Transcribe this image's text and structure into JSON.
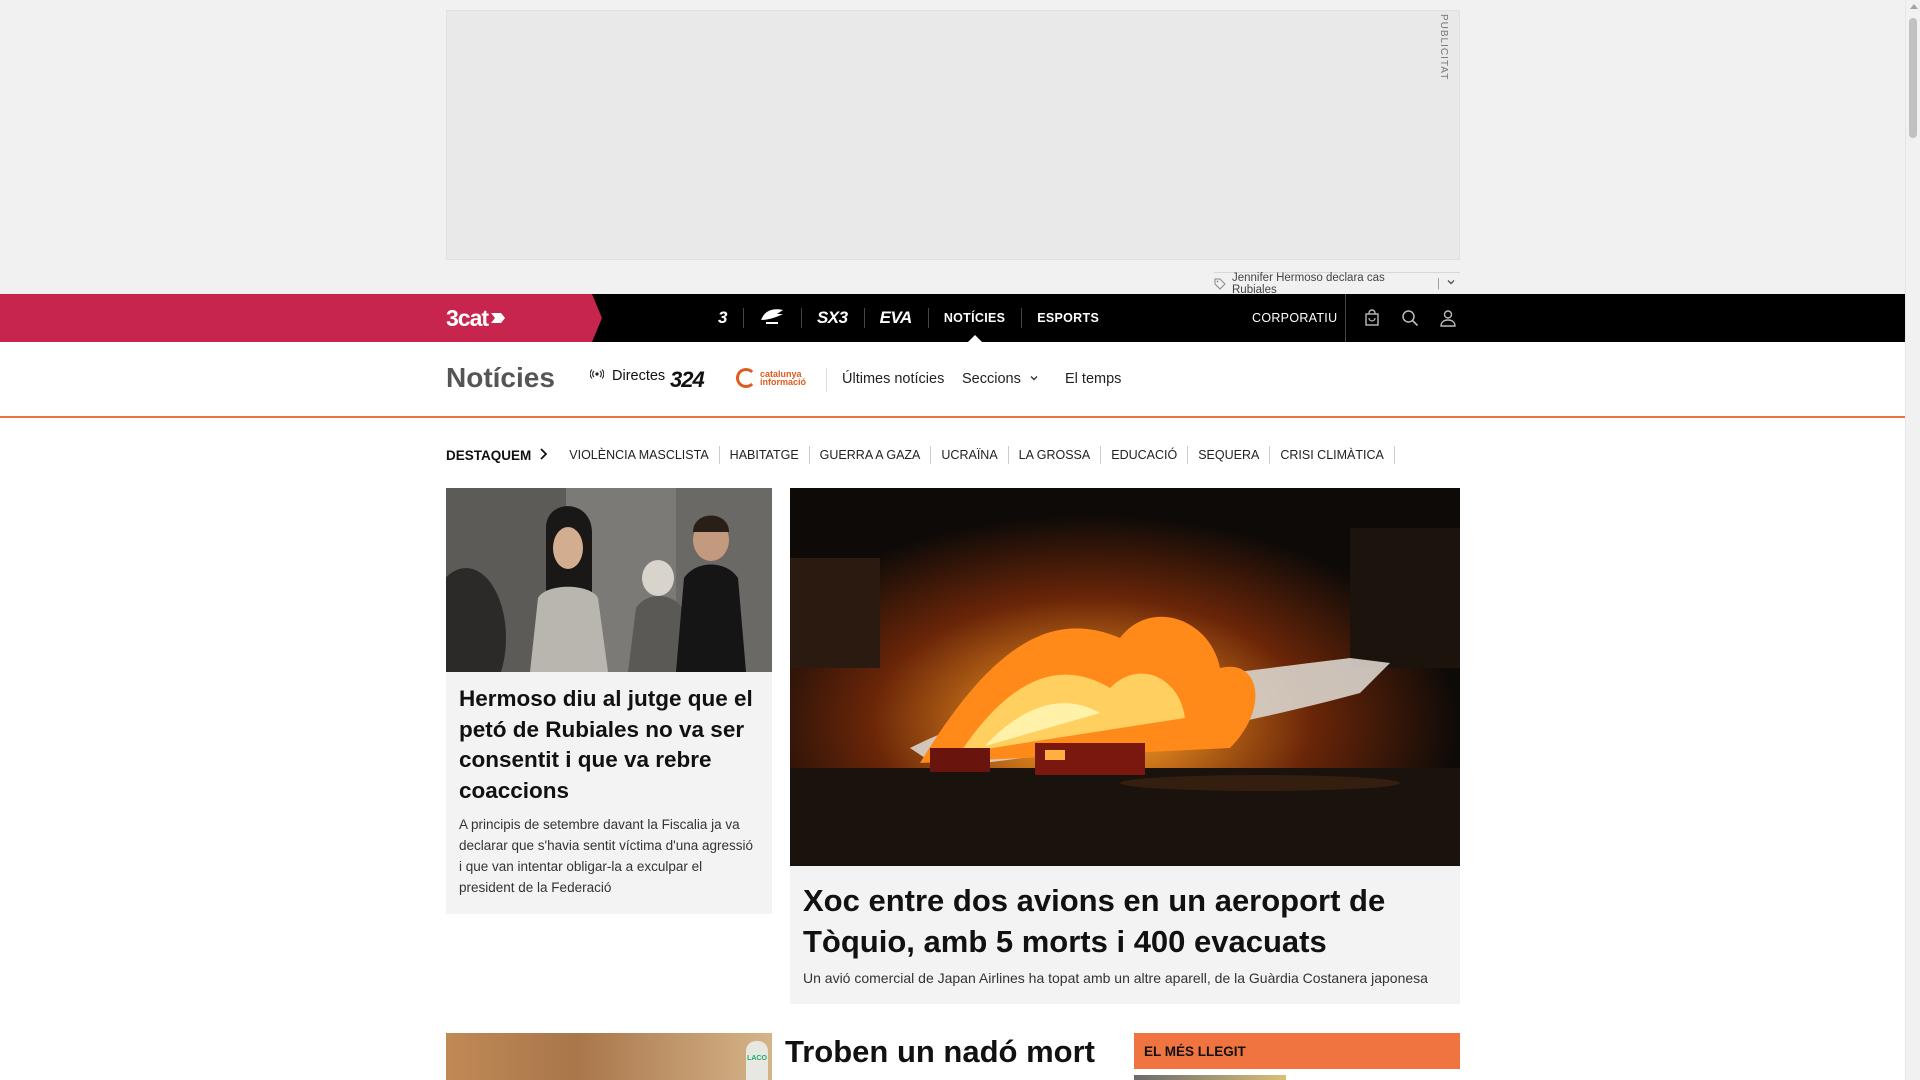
{
  "ad": {
    "label": "PUBLICITAT",
    "tag_text": "Jennifer Hermoso declara cas Rubiales",
    "tag_separator": "|"
  },
  "topnav": {
    "brand": "3cat",
    "channels": [
      {
        "label": "3",
        "icon": "tv3-logo"
      },
      {
        "label": "Cat Ràdio",
        "icon": "catradio-logo"
      },
      {
        "label": "SX3",
        "icon": "sx3-logo"
      },
      {
        "label": "EVA",
        "icon": "eva-logo"
      },
      {
        "label": "NOTÍCIES",
        "active": true
      },
      {
        "label": "ESPORTS"
      }
    ],
    "corporatiu": "CORPORATIU",
    "icons": [
      "shopping-bag-icon",
      "search-icon",
      "user-icon"
    ]
  },
  "section": {
    "title": "Notícies",
    "directes": "Directes",
    "logo_324": "324",
    "logo_catinfo_line1": "catalunya",
    "logo_catinfo_line2": "informació",
    "links": {
      "ultimes": "Últimes notícies",
      "seccions": "Seccions",
      "temps": "El temps"
    }
  },
  "destaquem": {
    "title": "DESTAQUEM",
    "items": [
      "VIOLÈNCIA MASCLISTA",
      "HABITATGE",
      "GUERRA A GAZA",
      "UCRAÏNA",
      "LA GROSSA",
      "EDUCACIÓ",
      "SEQUERA",
      "CRISI CLIMÀTICA"
    ]
  },
  "articles": {
    "left": {
      "headline": "Hermoso diu al jutge que el petó de Rubiales no va ser consentit i que va rebre coaccions",
      "summary": "A principis de setembre davant la Fiscalia ja va declarar que s'havia sentit víctima d'una agressió i que van intentar obligar-la a exculpar el president de la Federació"
    },
    "main": {
      "headline": "Xoc entre dos avions en un aeroport de Tòquio, amb 5 morts i 400 evacuats",
      "summary": "Un avió comercial de Japan Airlines ha topat amb un altre aparell, de la Guàrdia Costanera japonesa"
    },
    "bottom_center": {
      "headline": "Troben un nadó mort"
    },
    "bottom_left_sign": "LACO"
  },
  "mes_llegit": {
    "title": "EL MÉS LLEGIT"
  },
  "colors": {
    "brand_red": "#c7254e",
    "accent_orange": "#f0743f",
    "nav_black": "#000000"
  }
}
